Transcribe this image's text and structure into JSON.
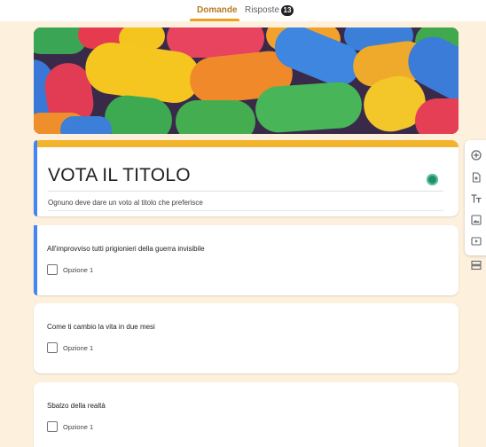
{
  "header": {
    "tabs": [
      {
        "label": "Domande",
        "active": true
      },
      {
        "label": "Risposte",
        "active": false
      }
    ],
    "responses_count": "13"
  },
  "theme": {
    "accent": "#f2b42c",
    "selected_bar": "#4285f4",
    "background": "#fdf1de"
  },
  "form": {
    "title": "VOTA IL TITOLO",
    "description": "Ognuno deve dare un voto al titolo che preferisce"
  },
  "questions": [
    {
      "text": "All'improvviso tutti prigionieri della guerra invisibile",
      "option": "Opzione 1"
    },
    {
      "text": "Come ti cambio la vita in due mesi",
      "option": "Opzione 1"
    },
    {
      "text": "Sbalzo della realtà",
      "option": "Opzione 1"
    }
  ],
  "toolbar": {
    "icons": [
      "add-question-icon",
      "import-questions-icon",
      "add-title-icon",
      "add-image-icon",
      "add-video-icon",
      "add-section-icon"
    ]
  }
}
